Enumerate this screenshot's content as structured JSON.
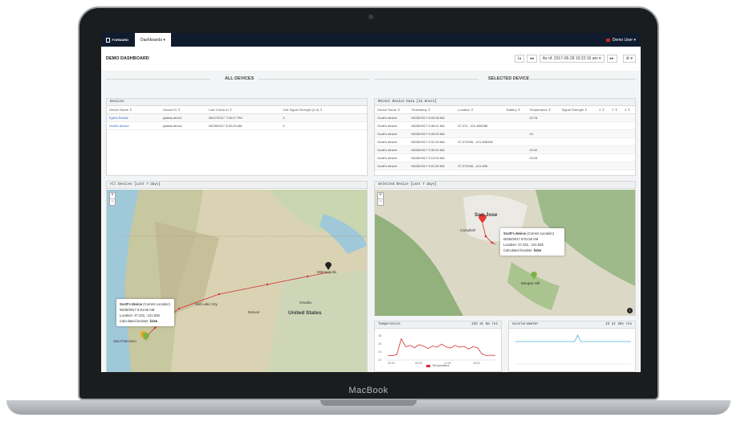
{
  "device_label": "MacBook",
  "navbar": {
    "logo_text": "FORWARD",
    "tab_label": "Dashboards ▾",
    "user_label": "Demo User ▾"
  },
  "titlebar": {
    "title": "DEMO DASHBOARD",
    "first_label": "|◂",
    "prev_label": "◂◂",
    "as_of_label": "As of: 2017-06-28 10:22:16 am ▾",
    "next_label": "▸▸",
    "settings_label": "⚙ ▾"
  },
  "sections": {
    "all_devices": "ALL DEVICES",
    "selected_device": "SELECTED DEVICE"
  },
  "devices_table": {
    "title": "Devices",
    "columns": [
      "Device Name ⇕",
      "Device ID ⇕",
      "Last Check-In ⇕",
      "Cell Signal Strength (0-4) ⇕"
    ],
    "rows": [
      [
        "Kyle's Device",
        "qdaba-dev10",
        "06/27/2017 7:06:27 PM",
        "4"
      ],
      [
        "Scott's device",
        "qdaba-dev1a",
        "06/28/2017 3:00:23 AM",
        "4"
      ]
    ]
  },
  "recent_table": {
    "title": "Recent Device Data [24 Hours]",
    "columns": [
      "Device Name ⇕",
      "Timestamp ⇕",
      "Location ⇕",
      "Battery ⇕",
      "Temperature ⇕",
      "Signal Strength ⇕",
      "X ⇕",
      "Y ⇕",
      "Z ⇕"
    ],
    "rows": [
      [
        "Scott's device",
        "06/28/2017 8:00:08 AM",
        "",
        "",
        "22.78",
        "",
        "",
        "",
        ""
      ],
      [
        "Scott's device",
        "06/28/2017 9:46:01 AM",
        "37.272, -121.835288",
        "",
        "",
        "",
        "",
        "",
        ""
      ],
      [
        "Scott's device",
        "06/28/2017 9:43:03 AM",
        "",
        "",
        "23",
        "",
        "",
        "",
        ""
      ],
      [
        "Scott's device",
        "06/28/2017 9:31:29 AM",
        "37.272035, -121.835280",
        "",
        "",
        "",
        "",
        "",
        ""
      ],
      [
        "Scott's device",
        "06/28/2017 9:30:02 AM",
        "",
        "",
        "23.00",
        "",
        "",
        "",
        ""
      ],
      [
        "Scott's device",
        "06/28/2017 9:13:03 AM",
        "",
        "",
        "23.25",
        "",
        "",
        "",
        ""
      ],
      [
        "Scott's device",
        "06/28/2017 9:01:30 AM",
        "37.272035, -121.835",
        "",
        "",
        "",
        "",
        "",
        ""
      ]
    ]
  },
  "map_all": {
    "title": "All Devices [Last 7 days]",
    "zoom_in": "+",
    "zoom_out": "−",
    "labels": {
      "minneapolis": "Minneapolis",
      "united_states": "United States",
      "salt_lake": "Salt Lake City",
      "san_francisco": "San Francisco",
      "omaha": "Omaha",
      "denver": "Denver"
    },
    "popup": {
      "title": "Scott's device",
      "subtitle": "(Current Location)",
      "time": "06/28/2017 8:01:50 AM",
      "location": "Location: 37.232, -121.835",
      "calculated_label": "Calculated location:",
      "calculated_value": "false"
    }
  },
  "map_selected": {
    "title": "Selected Device [Last 7 days]",
    "zoom_in": "+",
    "zoom_out": "−",
    "labels": {
      "san_jose": "San Jose",
      "campbell": "Campbell",
      "morgan_hill": "Morgan Hill"
    },
    "popup": {
      "title": "Scott's device",
      "subtitle": "(Current Location)",
      "time": "06/28/2017 8:01:50 AM",
      "location": "Location: 37.232, -121.835",
      "calculated_label": "Calculated location:",
      "calculated_value": "false"
    },
    "info": "i"
  },
  "temperature_chart": {
    "title": "Temperature",
    "range_label": "24h at 6m res",
    "legend": "Temperature",
    "x_labels": [
      "00:00",
      "06:00",
      "12:00",
      "18:00"
    ],
    "y_labels": [
      "28",
      "26",
      "24",
      "22"
    ]
  },
  "accelerometer_chart": {
    "title": "Accelerometer",
    "range_label": "1h at 30s res"
  },
  "chart_data": [
    {
      "type": "line",
      "title": "Temperature",
      "series": [
        {
          "name": "Temperature",
          "values": [
            23.0,
            23.0,
            23.2,
            26.8,
            25.0,
            25.3,
            24.8,
            25.5,
            25.1,
            24.6,
            25.2,
            24.9,
            25.6,
            25.0,
            24.7,
            25.3,
            24.9,
            25.1,
            24.5,
            25.0,
            24.8,
            23.4,
            23.0,
            23.1,
            23.0
          ]
        }
      ],
      "ylim": [
        22,
        28
      ]
    },
    {
      "type": "line",
      "title": "Accelerometer",
      "series": [
        {
          "values": [
            0,
            0,
            0,
            0,
            0,
            0,
            0,
            0,
            0,
            0,
            0,
            0,
            0,
            0,
            0,
            0,
            0,
            0,
            0,
            0,
            0,
            1,
            0,
            0,
            0,
            0,
            0,
            0,
            0,
            0,
            0,
            0,
            0,
            0,
            0,
            0,
            0,
            0,
            0,
            0
          ]
        }
      ],
      "ylim": [
        -1,
        1
      ]
    }
  ]
}
